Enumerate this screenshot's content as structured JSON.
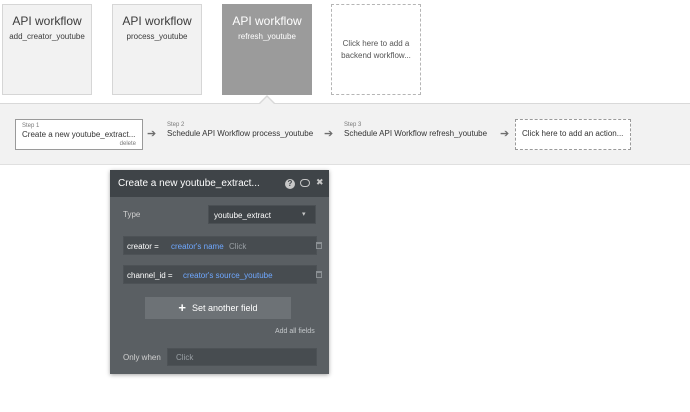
{
  "workflows": [
    {
      "title": "API workflow",
      "name": "add_creator_youtube"
    },
    {
      "title": "API workflow",
      "name": "process_youtube"
    },
    {
      "title": "API workflow",
      "name": "refresh_youtube"
    }
  ],
  "add_workflow": "Click here to add a backend workflow...",
  "steps": [
    {
      "label": "Step 1",
      "title": "Create a new youtube_extract...",
      "delete": "delete"
    },
    {
      "label": "Step 2",
      "title": "Schedule API Workflow process_youtube"
    },
    {
      "label": "Step 3",
      "title": "Schedule API Workflow refresh_youtube"
    }
  ],
  "add_action": "Click here to add an action...",
  "panel": {
    "title": "Create a new youtube_extract...",
    "help_icon": "?",
    "comment_icon": "speech-bubble",
    "close_icon": "✖",
    "type_label": "Type",
    "type_value": "youtube_extract",
    "fields": [
      {
        "key": "creator =",
        "value": "creator's name",
        "hint": "Click"
      },
      {
        "key": "channel_id =",
        "value": "creator's source_youtube",
        "hint": ""
      }
    ],
    "set_another": "Set another field",
    "add_all": "Add all fields",
    "only_when_label": "Only when",
    "only_when_placeholder": "Click"
  },
  "colors": {
    "active_card": "#9b9b9b",
    "panel_bg": "#5a5f63",
    "panel_header": "#3f4448",
    "link_blue": "#6fa8ff"
  }
}
